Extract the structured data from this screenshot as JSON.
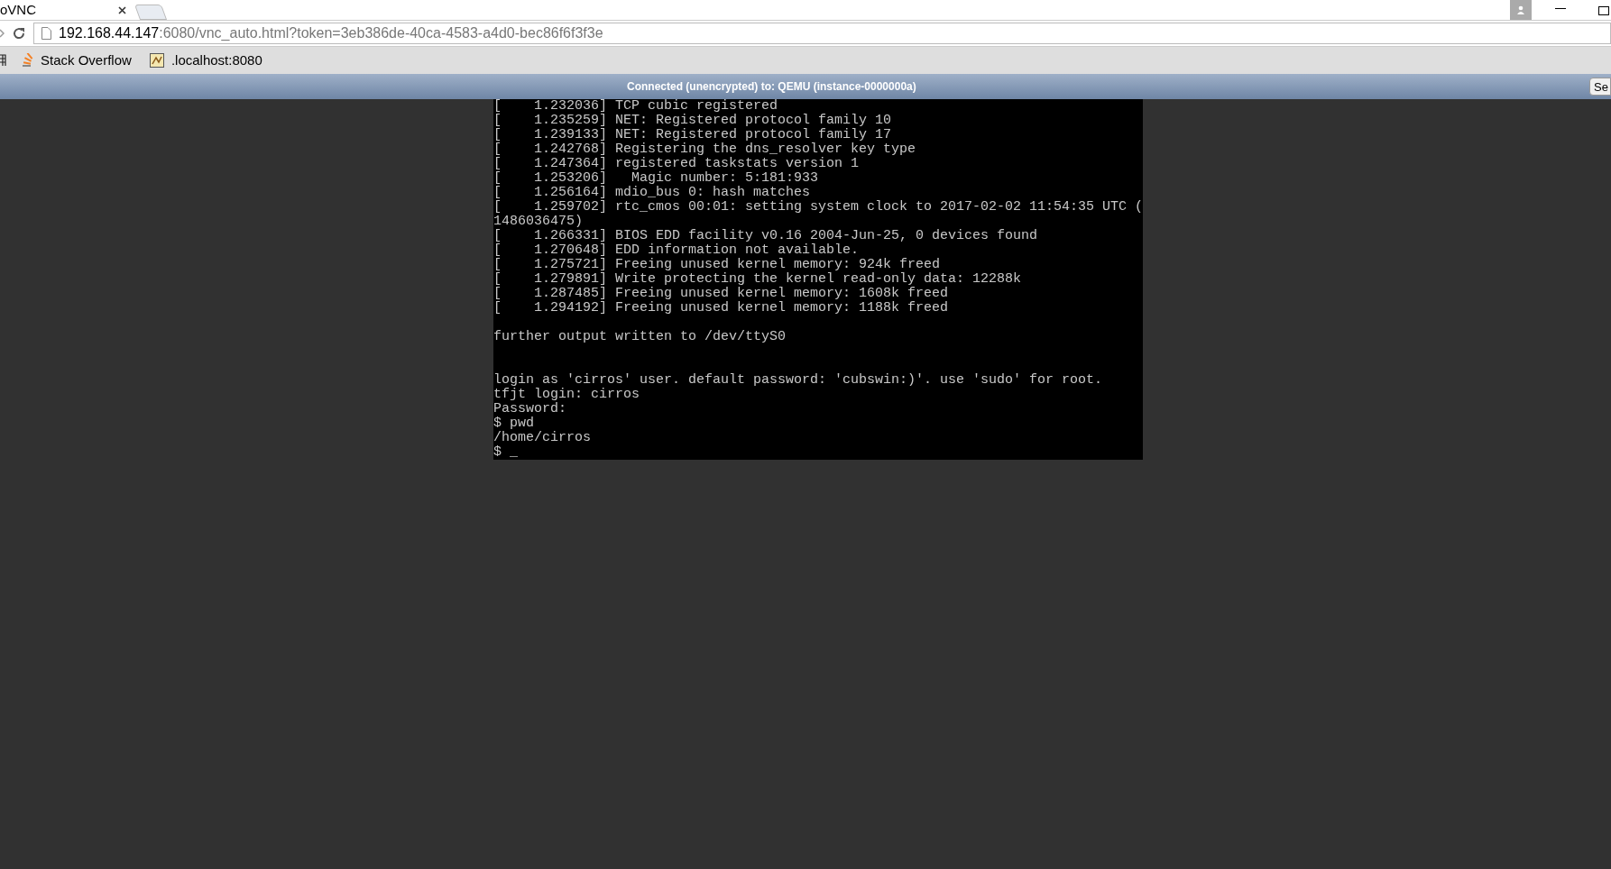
{
  "browser": {
    "tab": {
      "title": "oVNC",
      "selected": true
    },
    "address": {
      "host": "192.168.44.147",
      "rest": ":6080/vnc_auto.html?token=3eb386de-40ca-4583-a4d0-bec86f6f3f3e"
    },
    "bookmarks": [
      {
        "kind": "apps"
      },
      {
        "kind": "stackoverflow",
        "label": "Stack Overflow"
      },
      {
        "kind": "page",
        "label": ".localhost:8080"
      }
    ]
  },
  "vnc": {
    "status": "Connected (unencrypted) to: QEMU (instance-0000000a)",
    "button": "Se",
    "console": [
      {
        "kind": "text",
        "text": "[    1.232036] TCP cubic registered"
      },
      {
        "kind": "text",
        "text": "[    1.235259] NET: Registered protocol family 10"
      },
      {
        "kind": "text",
        "text": "[    1.239133] NET: Registered protocol family 17"
      },
      {
        "kind": "text",
        "text": "[    1.242768] Registering the dns_resolver key type"
      },
      {
        "kind": "text",
        "text": "[    1.247364] registered taskstats version 1"
      },
      {
        "kind": "text",
        "text": "[    1.253206]   Magic number: 5:181:933"
      },
      {
        "kind": "text",
        "text": "[    1.256164] mdio_bus 0: hash matches"
      },
      {
        "kind": "text",
        "text": "[    1.259702] rtc_cmos 00:01: setting system clock to 2017-02-02 11:54:35 UTC ("
      },
      {
        "kind": "text",
        "text": "1486036475)"
      },
      {
        "kind": "text",
        "text": "[    1.266331] BIOS EDD facility v0.16 2004-Jun-25, 0 devices found"
      },
      {
        "kind": "text",
        "text": "[    1.270648] EDD information not available."
      },
      {
        "kind": "text",
        "text": "[    1.275721] Freeing unused kernel memory: 924k freed"
      },
      {
        "kind": "text",
        "text": "[    1.279891] Write protecting the kernel read-only data: 12288k"
      },
      {
        "kind": "text",
        "text": "[    1.287485] Freeing unused kernel memory: 1608k freed"
      },
      {
        "kind": "text",
        "text": "[    1.294192] Freeing unused kernel memory: 1188k freed"
      },
      {
        "kind": "blank"
      },
      {
        "kind": "text",
        "text": "further output written to /dev/ttyS0"
      },
      {
        "kind": "blank"
      },
      {
        "kind": "blank"
      },
      {
        "kind": "text",
        "text": "login as 'cirros' user. default password: 'cubswin:)'. use 'sudo' for root."
      },
      {
        "kind": "text",
        "text": "tfjt login: cirros"
      },
      {
        "kind": "text",
        "text": "Password:"
      },
      {
        "kind": "text",
        "text": "$ pwd"
      },
      {
        "kind": "text",
        "text": "/home/cirros"
      },
      {
        "kind": "text",
        "text": "$ _"
      }
    ]
  }
}
